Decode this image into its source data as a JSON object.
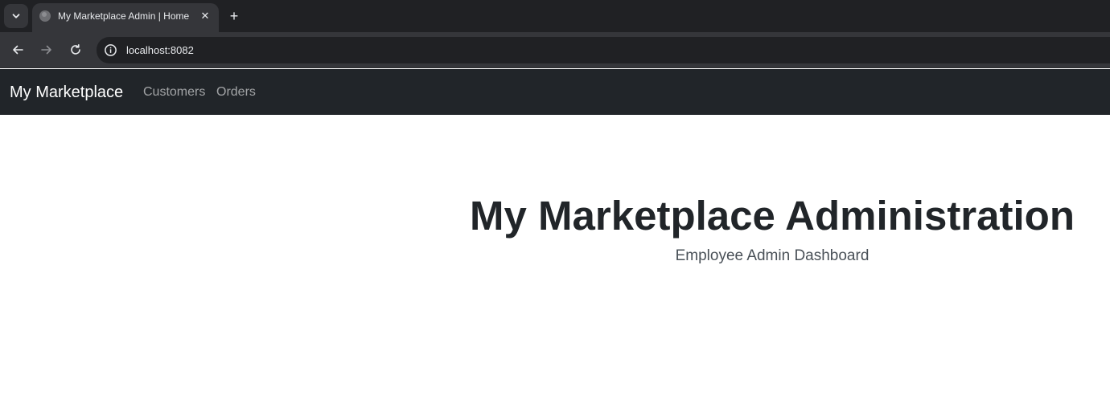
{
  "browser": {
    "tab": {
      "title": "My Marketplace Admin | Home",
      "close_symbol": "✕"
    },
    "new_tab_symbol": "+",
    "address_bar": {
      "url": "localhost:8082"
    },
    "colors": {
      "tabstrip_bg": "#202124",
      "toolbar_bg": "#35363a",
      "omnibox_bg": "#202124"
    }
  },
  "navbar": {
    "brand": "My Marketplace",
    "links": [
      {
        "label": "Customers"
      },
      {
        "label": "Orders"
      }
    ],
    "colors": {
      "background": "#212529"
    }
  },
  "main": {
    "title": "My Marketplace Administration",
    "subtitle": "Employee Admin Dashboard"
  }
}
